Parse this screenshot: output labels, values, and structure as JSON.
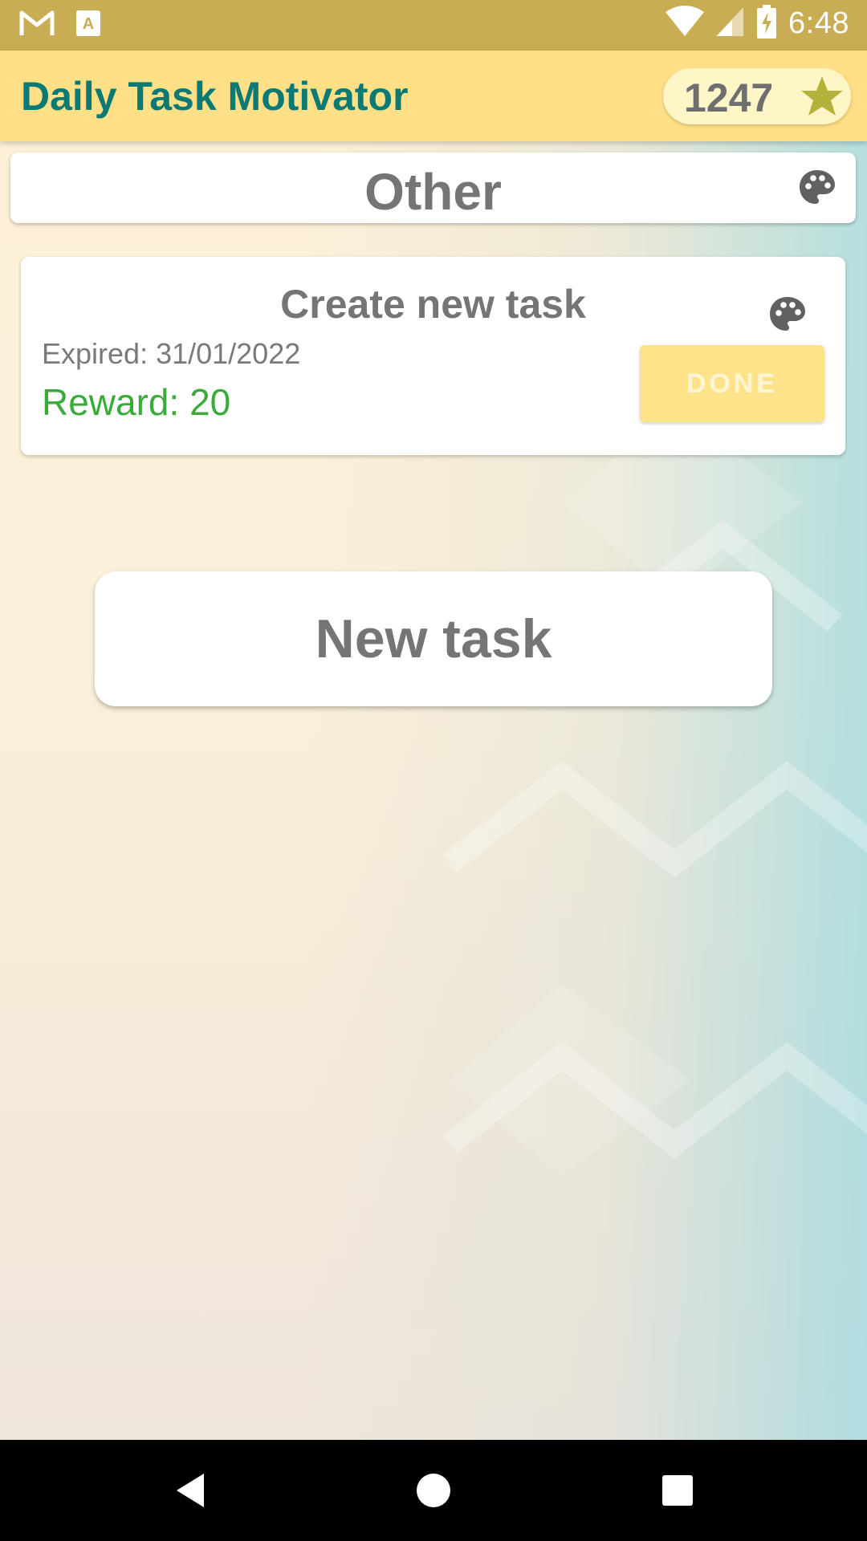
{
  "status_bar": {
    "time": "6:48",
    "icons": [
      "gmail-icon",
      "text-input-icon",
      "wifi-icon",
      "signal-icon",
      "battery-charging-icon"
    ]
  },
  "app_bar": {
    "title": "Daily Task Motivator",
    "score": "1247",
    "score_icon": "star-icon"
  },
  "category": {
    "title": "Other",
    "icon": "palette-icon"
  },
  "tasks": [
    {
      "title": "Create new task",
      "expired": "Expired: 31/01/2022",
      "reward": "Reward: 20",
      "done_label": "DONE",
      "icon": "palette-icon"
    }
  ],
  "new_task_label": "New task",
  "nav_bar": {
    "icons": [
      "back-icon",
      "home-icon",
      "recents-icon"
    ]
  },
  "colors": {
    "status_bar": "#c9ad52",
    "app_bar": "#ffe086",
    "title": "#0b7a75",
    "reward": "#3aaa3a",
    "done_button": "#ffe38a"
  }
}
